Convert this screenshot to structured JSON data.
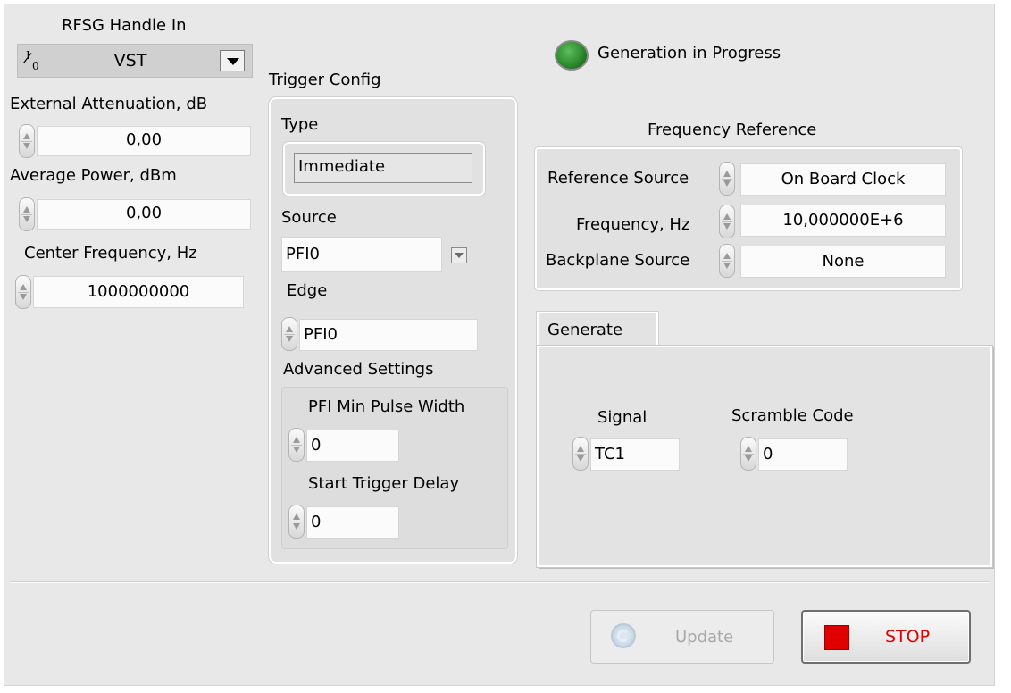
{
  "rfsg": {
    "label": "RFSG Handle In",
    "io_glyph": "I/O",
    "value": "VST"
  },
  "ext_atten": {
    "label": "External Attenuation, dB",
    "value": "0,00"
  },
  "avg_power": {
    "label": "Average Power, dBm",
    "value": "0,00"
  },
  "center_freq": {
    "label": "Center Frequency, Hz",
    "value": "1000000000"
  },
  "trigger": {
    "title": "Trigger Config",
    "type_label": "Type",
    "type_value": "Immediate",
    "source_label": "Source",
    "source_value": "PFI0",
    "edge_label": "Edge",
    "edge_value": "PFI0",
    "advanced_title": "Advanced Settings",
    "pulse_width_label": "PFI Min Pulse Width",
    "pulse_width_value": "0",
    "start_delay_label": "Start Trigger Delay",
    "start_delay_value": "0"
  },
  "status": {
    "label": "Generation in Progress",
    "led_color": "#2e8a2e"
  },
  "freq_ref": {
    "title": "Frequency Reference",
    "ref_source_label": "Reference Source",
    "ref_source_value": "On Board Clock",
    "frequency_label": "Frequency, Hz",
    "frequency_value": "10,000000E+6",
    "backplane_label": "Backplane Source",
    "backplane_value": "None"
  },
  "generate": {
    "tab_label": "Generate",
    "signal_label": "Signal",
    "signal_value": "TC1",
    "scramble_label": "Scramble Code",
    "scramble_value": "0"
  },
  "buttons": {
    "update_label": "Update",
    "update_icon": "refresh-icon",
    "stop_label": "STOP",
    "stop_color": "#e00000"
  }
}
